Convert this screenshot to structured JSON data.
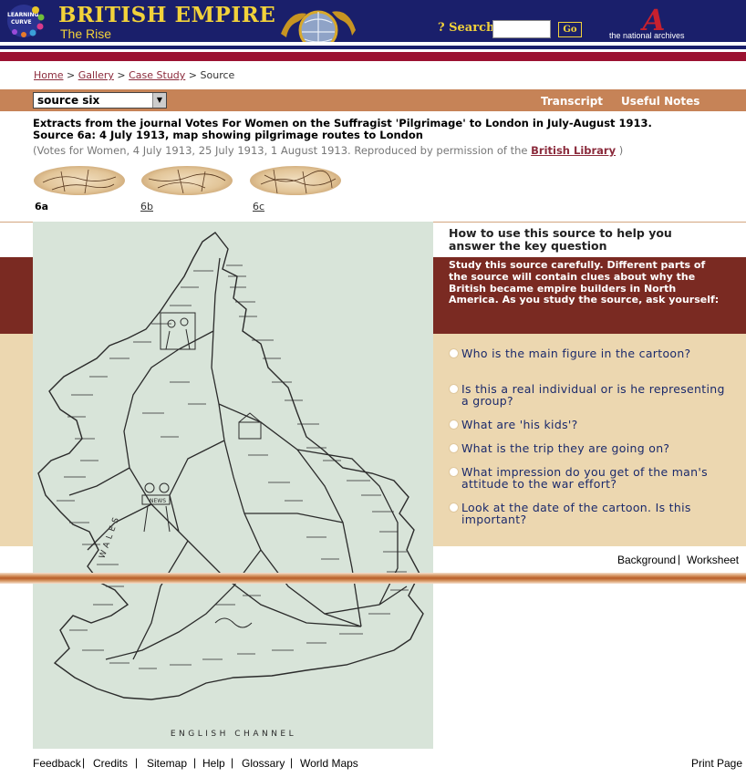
{
  "header": {
    "learning_curve_logo": "Learning Curve",
    "title": "BRITISH EMPIRE",
    "subtitle": "The Rise",
    "search_label": "? Search",
    "search_value": "",
    "go_label": "Go",
    "national_archives_logo": "A",
    "national_archives_text": "the national archives"
  },
  "breadcrumb": {
    "home": "Home",
    "gallery": "Gallery",
    "case_study": "Case Study",
    "current": "Source",
    "separator": ">"
  },
  "toolbar": {
    "source_select_value": "source six",
    "transcript": "Transcript",
    "useful_notes": "Useful Notes"
  },
  "description": {
    "line1": "Extracts from the journal Votes For Women on the Suffragist 'Pilgrimage' to London in July-August 1913.",
    "line2": "Source 6a: 4 July 1913, map showing pilgrimage routes to London",
    "credit_prefix": "(Votes for Women, 4 July 1913, 25 July 1913, 1 August 1913. Reproduced by permission of the",
    "credit_link": "British Library",
    "credit_suffix": ")"
  },
  "thumbnails": [
    {
      "label": "6a",
      "active": true
    },
    {
      "label": "6b",
      "active": false
    },
    {
      "label": "6c",
      "active": false
    }
  ],
  "map": {
    "sea_label": "ENGLISH CHANNEL",
    "country_label": "WALES",
    "banner_label": "NEWS"
  },
  "panel": {
    "howto_title": "How to use this source to help you answer the key question",
    "study_text": "Study this source carefully. Different parts of the source will contain clues about why the British became empire builders in North America. As you study the source, ask yourself:",
    "questions": [
      "Who is the main figure in the cartoon?",
      "Is this a real individual or is he representing a group?",
      "What are 'his kids'?",
      "What is the trip they are going on?",
      "What impression do you get of the man's  attitude to the war effort?",
      "Look at the date of the cartoon. Is this important?"
    ]
  },
  "links": {
    "background": "Background",
    "separator": "|",
    "worksheet": "Worksheet"
  },
  "footer": {
    "feedback": "Feedback",
    "credits": "Credits",
    "sitemap": "Sitemap",
    "help": "Help",
    "glossary": "Glossary",
    "world_maps": "World Maps",
    "print_page": "Print Page",
    "separator": "|"
  },
  "colors": {
    "header_navy": "#1a1f6b",
    "title_gold": "#f2d23a",
    "crimson": "#9b1231",
    "tan_bar": "#c68357",
    "dark_band": "#7a2a22",
    "light_band": "#ecd7b0",
    "question_text": "#1b2a6b"
  }
}
